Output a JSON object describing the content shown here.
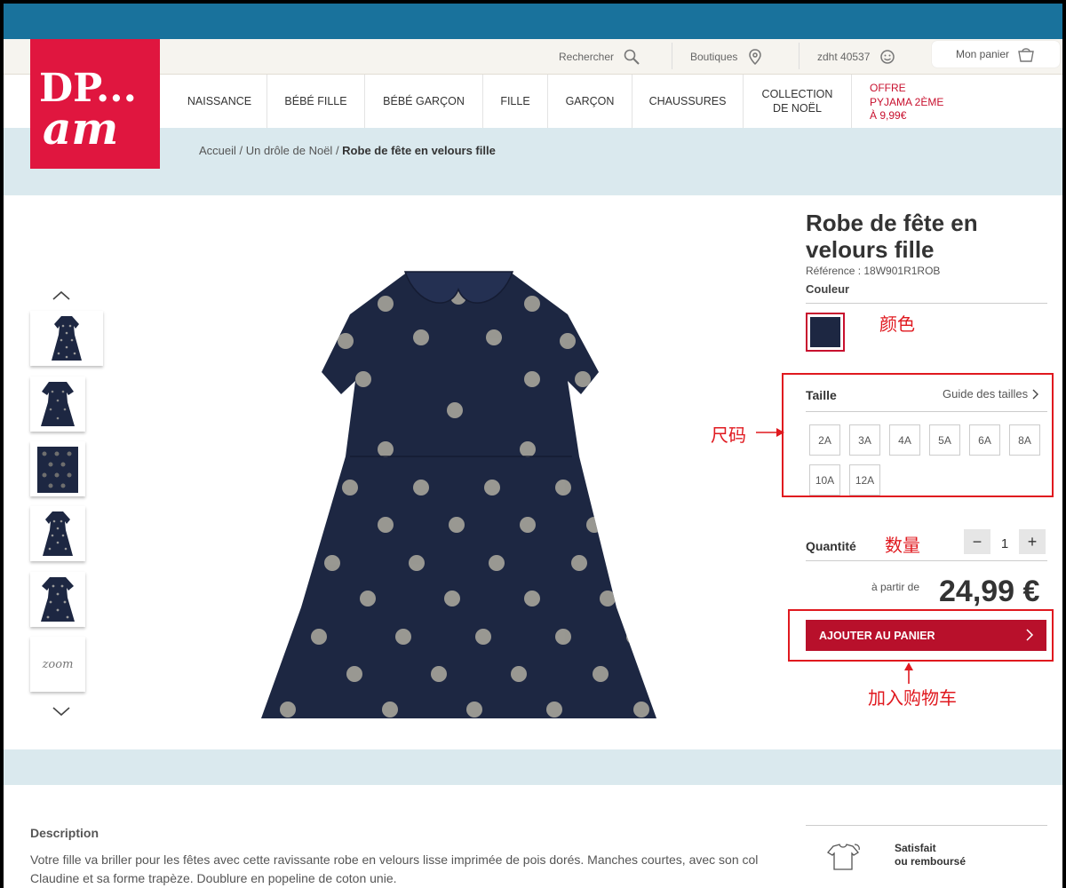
{
  "header": {
    "search_label": "Rechercher",
    "stores_label": "Boutiques",
    "user_label": "zdht 40537",
    "cart_label": "Mon panier"
  },
  "logo": {
    "line1": "DP...",
    "line2": "am"
  },
  "nav": {
    "items": [
      "NAISSANCE",
      "BÉBÉ FILLE",
      "BÉBÉ GARÇON",
      "FILLE",
      "GARÇON",
      "CHAUSSURES"
    ],
    "collection_line1": "COLLECTION",
    "collection_line2": "DE NOËL",
    "offer_line1": "OFFRE",
    "offer_line2": "PYJAMA 2ÈME",
    "offer_line3": "À 9,99€"
  },
  "breadcrumb": {
    "home": "Accueil",
    "category": "Un drôle de Noël",
    "current": "Robe de fête en velours fille",
    "sep": " / "
  },
  "thumbnails": {
    "zoom_label": "zoom"
  },
  "product": {
    "title_line1": "Robe de fête en",
    "title_line2": "velours fille",
    "reference": "Référence : 18W901R1ROB",
    "color_label": "Couleur",
    "size_label": "Taille",
    "size_guide": "Guide des tailles",
    "sizes": [
      "2A",
      "3A",
      "4A",
      "5A",
      "6A",
      "8A",
      "10A",
      "12A"
    ],
    "quantity_label": "Quantité",
    "quantity": "1",
    "qty_minus": "−",
    "qty_plus": "+",
    "price_prefix": "à partir de",
    "price": "24,99 €",
    "add_to_cart": "AJOUTER AU PANIER"
  },
  "annotations": {
    "color": "颜色",
    "size": "尺码",
    "quantity": "数量",
    "add_to_cart": "加入购物车"
  },
  "description": {
    "title": "Description",
    "text": "Votre fille va briller pour les fêtes avec cette ravissante robe en velours lisse imprimée de pois dorés. Manches courtes, avec son col Claudine et sa forme trapèze. Doublure en popeline de coton unie."
  },
  "guarantee": {
    "line1": "Satisfait",
    "line2": "ou remboursé"
  },
  "colors": {
    "brand_red": "#e0163f",
    "topbar_blue": "#19729c",
    "cart_button": "#b8102b",
    "dress_navy": "#1d2742"
  }
}
